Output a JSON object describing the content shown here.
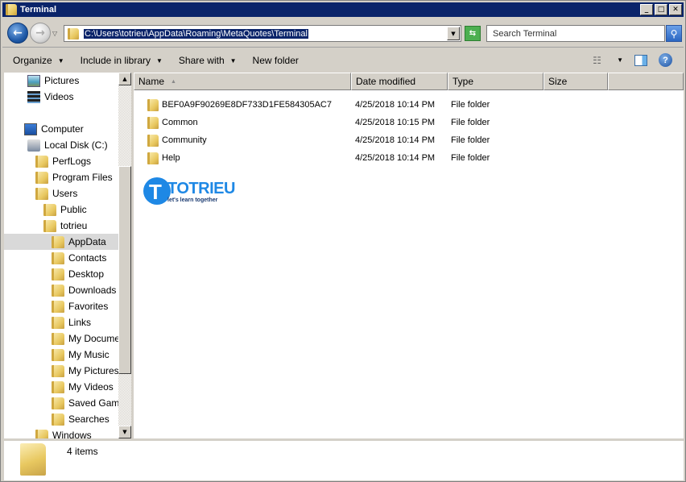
{
  "window": {
    "title": "Terminal",
    "controls": [
      "minimize",
      "maximize",
      "close"
    ]
  },
  "navigation": {
    "address": "C:\\Users\\totrieu\\AppData\\Roaming\\MetaQuotes\\Terminal",
    "search_placeholder": "Search Terminal"
  },
  "toolbar": {
    "organize": "Organize",
    "include_in_library": "Include in library",
    "share_with": "Share with",
    "new_folder": "New folder"
  },
  "sidebar": {
    "items": [
      {
        "label": "Pictures",
        "icon": "pictures-library-icon",
        "indent": 1
      },
      {
        "label": "Videos",
        "icon": "videos-library-icon",
        "indent": 1
      },
      {
        "label": "Computer",
        "icon": "computer-icon",
        "indent": 0
      },
      {
        "label": "Local Disk (C:)",
        "icon": "local-disk-icon",
        "indent": 1
      },
      {
        "label": "PerfLogs",
        "icon": "folder-icon",
        "indent": 2
      },
      {
        "label": "Program Files",
        "icon": "folder-icon",
        "indent": 2
      },
      {
        "label": "Users",
        "icon": "folder-icon",
        "indent": 2
      },
      {
        "label": "Public",
        "icon": "folder-icon",
        "indent": 3
      },
      {
        "label": "totrieu",
        "icon": "user-folder-locked-icon",
        "indent": 3
      },
      {
        "label": "AppData",
        "icon": "folder-icon",
        "indent": 4,
        "selected": true
      },
      {
        "label": "Contacts",
        "icon": "contacts-folder-icon",
        "indent": 4
      },
      {
        "label": "Desktop",
        "icon": "desktop-folder-icon",
        "indent": 4
      },
      {
        "label": "Downloads",
        "icon": "downloads-folder-icon",
        "indent": 4
      },
      {
        "label": "Favorites",
        "icon": "favorites-folder-icon",
        "indent": 4
      },
      {
        "label": "Links",
        "icon": "links-folder-icon",
        "indent": 4
      },
      {
        "label": "My Documen",
        "icon": "documents-folder-icon",
        "indent": 4
      },
      {
        "label": "My Music",
        "icon": "music-folder-icon",
        "indent": 4
      },
      {
        "label": "My Pictures",
        "icon": "pictures-folder-icon",
        "indent": 4
      },
      {
        "label": "My Videos",
        "icon": "videos-folder-icon",
        "indent": 4
      },
      {
        "label": "Saved Game",
        "icon": "saved-games-folder-icon",
        "indent": 4
      },
      {
        "label": "Searches",
        "icon": "searches-folder-icon",
        "indent": 4
      },
      {
        "label": "Windows",
        "icon": "folder-icon",
        "indent": 2
      }
    ]
  },
  "columns": {
    "name": "Name",
    "date_modified": "Date modified",
    "type": "Type",
    "size": "Size"
  },
  "files": [
    {
      "name": "BEF0A9F90269E8DF733D1FE584305AC7",
      "date": "4/25/2018 10:14 PM",
      "type": "File folder"
    },
    {
      "name": "Common",
      "date": "4/25/2018 10:15 PM",
      "type": "File folder"
    },
    {
      "name": "Community",
      "date": "4/25/2018 10:14 PM",
      "type": "File folder"
    },
    {
      "name": "Help",
      "date": "4/25/2018 10:14 PM",
      "type": "File folder"
    }
  ],
  "watermark": {
    "brand": "TOTRIEU",
    "tagline": "let's learn together"
  },
  "details": {
    "item_count": "4 items"
  },
  "colors": {
    "titlebar": "#0a246a",
    "selection": "#0a246a",
    "brand_blue": "#1e88e5"
  }
}
